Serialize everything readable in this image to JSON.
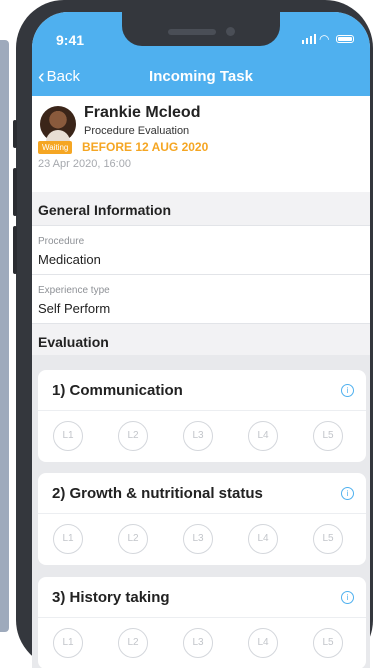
{
  "status_bar": {
    "time": "9:41"
  },
  "nav": {
    "back_label": "Back",
    "title": "Incoming Task"
  },
  "task": {
    "name": "Frankie Mcleod",
    "subtitle": "Procedure Evaluation",
    "badge": "Waiting",
    "deadline": "BEFORE 12 AUG 2020",
    "datetime": "23 Apr 2020, 16:00"
  },
  "general": {
    "heading": "General Information",
    "fields": [
      {
        "label": "Procedure",
        "value": "Medication"
      },
      {
        "label": "Experience type",
        "value": "Self Perform"
      }
    ]
  },
  "evaluation": {
    "heading": "Evaluation",
    "items": [
      {
        "title": "1) Communication",
        "levels": [
          "L1",
          "L2",
          "L3",
          "L4",
          "L5"
        ]
      },
      {
        "title": "2) Growth & nutritional status",
        "levels": [
          "L1",
          "L2",
          "L3",
          "L4",
          "L5"
        ]
      },
      {
        "title": "3) History taking",
        "levels": [
          "L1",
          "L2",
          "L3",
          "L4",
          "L5"
        ]
      }
    ]
  },
  "colors": {
    "primary": "#4fb0ef",
    "warning": "#f5a623",
    "frame": "#34373d"
  }
}
